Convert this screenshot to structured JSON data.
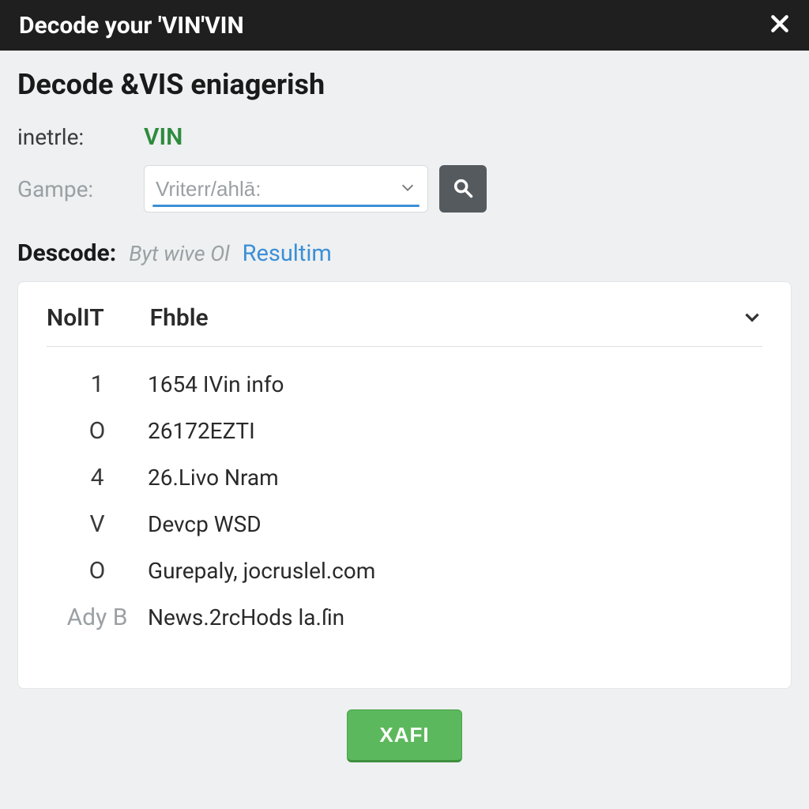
{
  "titlebar": {
    "title": "Decode your 'VIN'VIN"
  },
  "page": {
    "heading": "Decode &VIS eniagerish"
  },
  "form": {
    "row1_label": "inetrle:",
    "row1_value": "VIN",
    "row2_label": "Gampe:",
    "select_placeholder": "Vriterr/ahlā:"
  },
  "decode": {
    "label": "Descode:",
    "sub": "Byt wive Ol",
    "link": "Resultim"
  },
  "table": {
    "head_col1": "NolIT",
    "head_col2": "Fhble",
    "rows": [
      {
        "c1": "1",
        "c2": "1654 IVin info",
        "muted": false
      },
      {
        "c1": "O",
        "c2": "26172EZTI",
        "muted": false
      },
      {
        "c1": "4",
        "c2": "26.Livo Nram",
        "muted": false
      },
      {
        "c1": "V",
        "c2": "Devcp WSD",
        "muted": false
      },
      {
        "c1": "O",
        "c2": "Gurepaly, jocruslel.com",
        "muted": false
      },
      {
        "c1": "Ady B",
        "c2": "News.2rcHods la.ſin",
        "muted": true
      }
    ]
  },
  "footer": {
    "action": "XAFI"
  }
}
